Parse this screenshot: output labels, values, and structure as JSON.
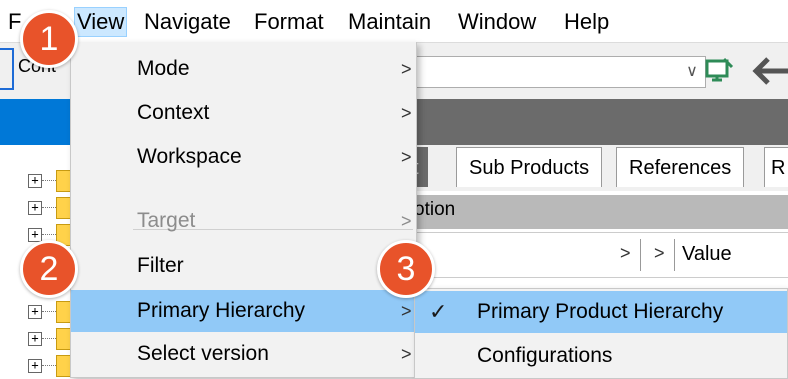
{
  "menubar": {
    "items": [
      "F",
      "View",
      "Navigate",
      "Format",
      "Maintain",
      "Window",
      "Help"
    ]
  },
  "toolbar": {
    "left_text": "Cont",
    "combo_arrow": "∨"
  },
  "tabs": [
    "t",
    "Sub Products",
    "References",
    "R"
  ],
  "columns": {
    "header_text": "otion",
    "chevron1": ">",
    "chevron2": ">",
    "value_label": "Value"
  },
  "view_menu": {
    "items": [
      {
        "label": "Mode",
        "arrow": ">"
      },
      {
        "label": "Context",
        "arrow": ">"
      },
      {
        "label": "Workspace",
        "arrow": ">"
      },
      {
        "label": "Target",
        "arrow": ">"
      },
      {
        "label": "Filter",
        "arrow": ""
      },
      {
        "label": "Primary Hierarchy",
        "arrow": ">"
      },
      {
        "label": "Select version",
        "arrow": ">"
      }
    ]
  },
  "submenu": {
    "items": [
      {
        "label": "Primary Product Hierarchy",
        "check": "✓"
      },
      {
        "label": "Configurations",
        "check": ""
      }
    ]
  },
  "callouts": [
    "1",
    "2",
    "3"
  ],
  "colors": {
    "accent_blue": "#0078d7",
    "menu_hover": "#91c9f7",
    "callout": "#e8532a"
  }
}
